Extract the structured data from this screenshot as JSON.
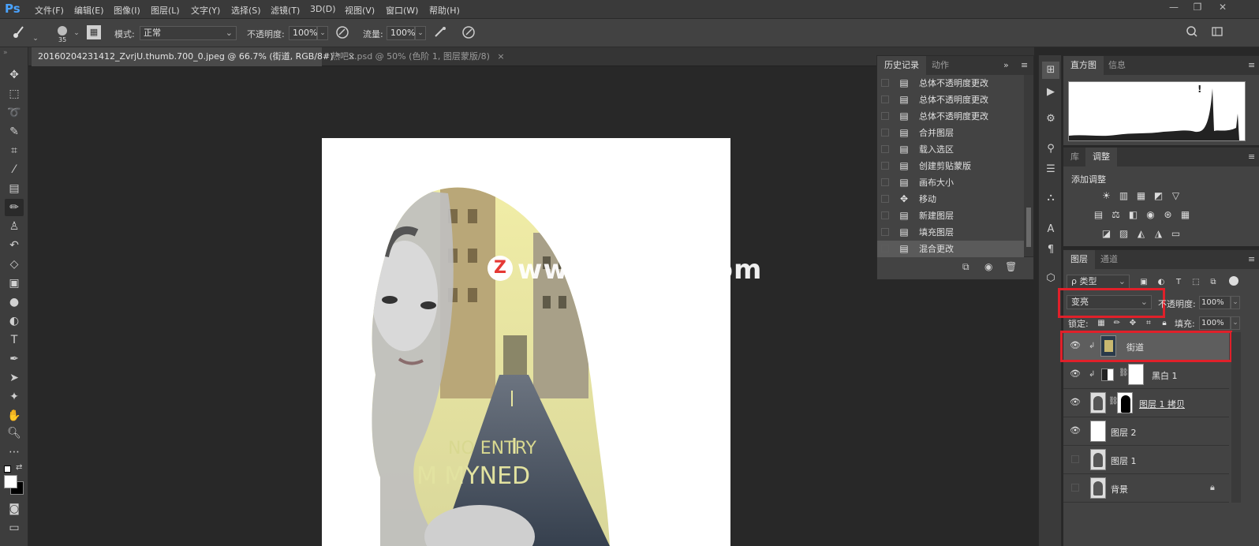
{
  "app": {
    "logo": "Ps"
  },
  "menu": [
    "文件(F)",
    "编辑(E)",
    "图像(I)",
    "图层(L)",
    "文字(Y)",
    "选择(S)",
    "滤镜(T)",
    "3D(D)",
    "视图(V)",
    "窗口(W)",
    "帮助(H)"
  ],
  "window_controls": {
    "minimize": "—",
    "restore": "❐",
    "close": "✕"
  },
  "options": {
    "brush_size": "35",
    "mode_label": "模式:",
    "mode_value": "正常",
    "opacity_label": "不透明度:",
    "opacity_value": "100%",
    "flow_label": "流量:",
    "flow_value": "100%"
  },
  "tabs": [
    {
      "label": "20160204231412_ZvrjU.thumb.700_0.jpeg @ 66.7% (街道, RGB/8#) *",
      "close": "×"
    },
    {
      "label": "热吧2.psd @ 50% (色阶 1, 图层蒙版/8)",
      "close": "×"
    }
  ],
  "canvas_image": {
    "street_text_1": "NO ENTRY",
    "street_text_2": "M MYNED"
  },
  "watermark": {
    "logo": "Z",
    "text": "www.MacZ.com"
  },
  "history_panel": {
    "tab_history": "历史记录",
    "tab_actions": "动作",
    "collapse": "»",
    "items": [
      "总体不透明度更改",
      "总体不透明度更改",
      "总体不透明度更改",
      "合并图层",
      "载入选区",
      "创建剪贴蒙版",
      "画布大小",
      "移动",
      "新建图层",
      "填充图层",
      "混合更改"
    ],
    "selected_index": 10
  },
  "histogram_panel": {
    "tab_histogram": "直方图",
    "tab_info": "信息",
    "warning": "!"
  },
  "adjustments_panel": {
    "tab_library": "库",
    "tab_adjustments": "调整",
    "title": "添加调整"
  },
  "layers_panel": {
    "tab_layers": "图层",
    "tab_channels": "通道",
    "filter_label": "ρ 类型",
    "blend_mode": "变亮",
    "opacity_label": "不透明度:",
    "opacity_value": "100%",
    "lock_label": "锁定:",
    "fill_label": "填充:",
    "fill_value": "100%",
    "layers": [
      {
        "name": "街道",
        "visible": true,
        "selected": true,
        "clipped": true,
        "thumb": "photo"
      },
      {
        "name": "黑白 1",
        "visible": true,
        "selected": false,
        "clipped": true,
        "thumb": "adjustment"
      },
      {
        "name": "图层 1 拷贝",
        "visible": true,
        "selected": false,
        "clipped": false,
        "thumb": "portrait-mask"
      },
      {
        "name": "图层 2",
        "visible": true,
        "selected": false,
        "clipped": false,
        "thumb": "white"
      },
      {
        "name": "图层 1",
        "visible": false,
        "selected": false,
        "clipped": false,
        "thumb": "portrait"
      },
      {
        "name": "背景",
        "visible": false,
        "selected": false,
        "clipped": false,
        "thumb": "portrait",
        "locked": true
      }
    ]
  },
  "colors": {
    "accent": "#4aa3ff",
    "highlight": "#e0202a"
  }
}
